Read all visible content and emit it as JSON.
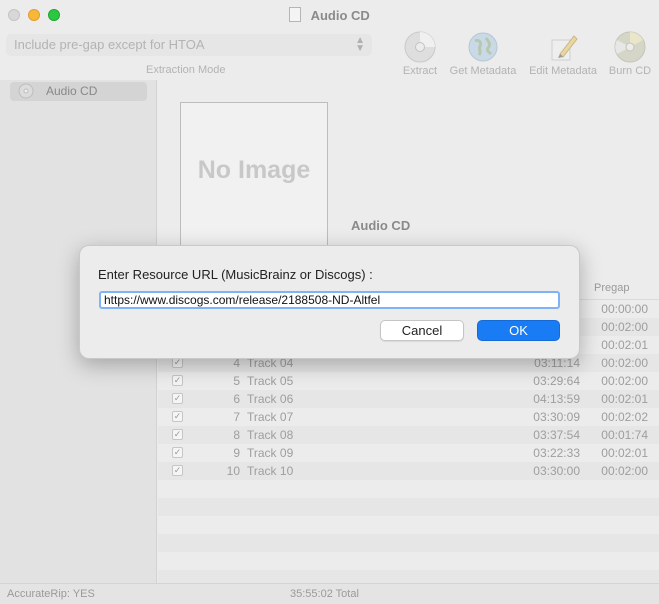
{
  "window": {
    "title": "Audio CD"
  },
  "toolbar": {
    "extraction_mode_value": "Include pre-gap except for HTOA",
    "extraction_mode_label": "Extraction Mode",
    "buttons": [
      {
        "label": "Extract",
        "icon": "cd-disc-icon"
      },
      {
        "label": "Get Metadata",
        "icon": "globe-icon"
      },
      {
        "label": "Edit Metadata",
        "icon": "pencil-icon"
      },
      {
        "label": "Burn CD",
        "icon": "burn-disc-icon"
      }
    ]
  },
  "sidebar": {
    "items": [
      {
        "label": "Audio CD",
        "icon": "cd-icon"
      }
    ]
  },
  "album": {
    "cover_placeholder": "No Image",
    "title": "Audio CD"
  },
  "table": {
    "headers": {
      "pregap": "Pregap"
    },
    "rows": [
      {
        "num": "4",
        "title": "Track 04",
        "duration": "03:11:14",
        "pregap": "00:02:00"
      },
      {
        "num": "5",
        "title": "Track 05",
        "duration": "03:29:64",
        "pregap": "00:02:00"
      },
      {
        "num": "6",
        "title": "Track 06",
        "duration": "04:13:59",
        "pregap": "00:02:01"
      },
      {
        "num": "7",
        "title": "Track 07",
        "duration": "03:30:09",
        "pregap": "00:02:02"
      },
      {
        "num": "8",
        "title": "Track 08",
        "duration": "03:37:54",
        "pregap": "00:01:74"
      },
      {
        "num": "9",
        "title": "Track 09",
        "duration": "03:22:33",
        "pregap": "00:02:01"
      },
      {
        "num": "10",
        "title": "Track 10",
        "duration": "03:30:00",
        "pregap": "00:02:00"
      }
    ],
    "visible_partial_pregaps": [
      "00:00:00",
      "00:02:00",
      "00:02:01"
    ]
  },
  "statusbar": {
    "accuraterip": "AccurateRip:  YES",
    "total": "35:55:02 Total"
  },
  "dialog": {
    "prompt": "Enter Resource URL (MusicBrainz or Discogs) :",
    "url_value": "https://www.discogs.com/release/2188508-ND-Altfel",
    "cancel_label": "Cancel",
    "ok_label": "OK"
  },
  "colors": {
    "accent": "#1a7cf5",
    "focus_ring": "#7fb3f5",
    "close": "#d8d8d8",
    "minimize": "#f9b73a",
    "zoom": "#2ac940"
  }
}
